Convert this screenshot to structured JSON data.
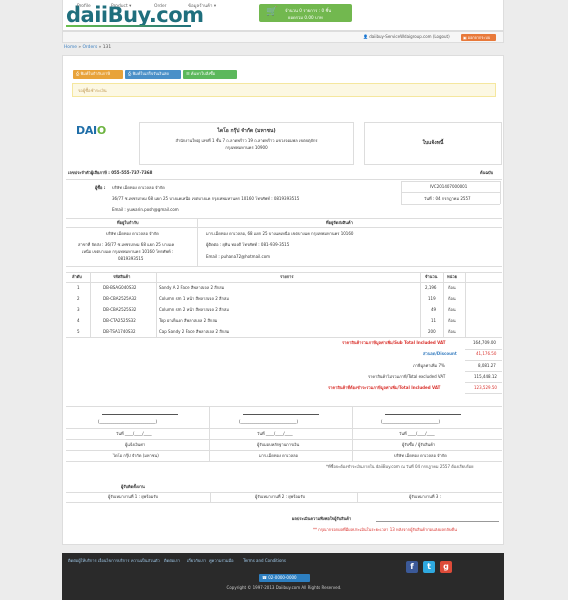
{
  "header": {
    "logo_text": "daiiBuy.com",
    "cart_line1": "จำนวน 0 รายการ : 0 ชิ้น",
    "cart_line2": "ยอดรวม 0.00 บาท",
    "user_text": "daiibuy-ServiceWdaigroup.com (Logout)",
    "logout_label": "ออกจากระบบ"
  },
  "nav": {
    "items": [
      "Profile",
      "Product ▾",
      "Order",
      "ข้อมูลร้านค้า ▾"
    ]
  },
  "breadcrumb": {
    "home": "Home",
    "orders": "Orders",
    "sep": "»",
    "current": "131"
  },
  "actions": {
    "print": "พิมพ์ใบกำกับภาษี",
    "print2": "พิมพ์ใบเสร็จรับเงินสด",
    "search": "ค้นหาใบสั่งซื้อ"
  },
  "notice": "รอผู้ซื้อชำระเงิน",
  "company": {
    "logo": "DAIO",
    "name": "ไดโอ กรุ๊ป จำกัด (มหาชน)",
    "addr1": "สำนักงานใหญ่ เลขที่ 1 ชั้น 7 ถ.ลาดพร้าว 19 ถ.ลาดพร้าว แขวงจอมพล เขตจตุจักร",
    "addr2": "กรุงเทพมหานคร 10900"
  },
  "tax": {
    "title": "ใบแจ้งหนี้",
    "invoice_no": "IVC201407000001",
    "date": "วันที่ : 04 กรกฎาคม 2557"
  },
  "seller_tax_id": "เลขประจำตัวผู้เสียภาษี : 055-555-737-7368",
  "original_label": "ต้นฉบับ",
  "customer": {
    "name_label": "ผู้ซื้อ :",
    "name": "บริษัท เม็ดทอง ดาเวลลอ จำกัด",
    "address": "36/77 ซ.เพชรเกษม 68 แยก 25 บางแคเหนือ เขตบางแค กรุงเทพมหานคร 10160 โทรศัพท์ : 0819393515",
    "email": "Email : yuwarin.posh@gmail.com"
  },
  "address_boxes": {
    "billing_title": "ที่อยู่ใบกำกับ",
    "billing_name": "บริษัท เม็ดทอง ดาเวลลอ จำกัด",
    "billing_addr": "สาขาที่ จัดส่ง : 36/77 ซ.เพชรเกษม 68 แยก 25 บางแค",
    "billing_addr2": "เหนือ เขตบางแค กรุงเทพมหานคร 10160 โทรศัพท์ :",
    "billing_phone": "0819393515",
    "shipping_title": "ที่อยู่จัดส่งสินค้า",
    "shipping_addr": "มาร.เม็ดทอง ดาเวลลอ, 68 แยก 25 บางแคเหนือ เขตบางแค กรุงเทพมหานคร 10160",
    "shipping_contact": "ผู้ติดต่อ : ยุพิน ทองดี โทรศัพท์ : 081-939-3515",
    "shipping_email": "Email : puhana72@hotmail.com"
  },
  "table": {
    "headers": [
      "ลำดับ",
      "รหัสสินค้า",
      "รายการ",
      "จำนวน",
      "หน่วย"
    ],
    "rows": [
      [
        "1",
        "DB-BSAG040S32",
        "Sandy A 2 Face สีพลาสเจล 2 สีกล่ม",
        "2,196",
        "ก้อน"
      ],
      [
        "2",
        "DB-CBA2525A32",
        "Column sm 1 หน้า สีพลาสเจล 2 สีกล่ม",
        "119",
        "ก้อน"
      ],
      [
        "3",
        "DB-CBA2525S32",
        "Column sm 2 หน้า สีพลาสเจล 2 สีกล่ม",
        "49",
        "ก้อน"
      ],
      [
        "4",
        "DB-CTA2525S32",
        "Top ฝาเห็นงก สีพลาสเจล 2 สีกล่ม",
        "11",
        "ก้อน"
      ],
      [
        "5",
        "DB-TSA1740S32",
        "Cap Sandy 2 Face สีพลาสเจล 2 สีกล่ม",
        "200",
        "ก้อน"
      ]
    ]
  },
  "totals": {
    "sub_label": "ราคาสินค้ารวมภาษีมูลค่าเพิ่ม/Sub Total Included VAT",
    "sub_value": "164,709.00",
    "discount_label": "ส่วนลด/Discount",
    "discount_value": "41,176.50",
    "vat_label": "ภาษีมูลค่าเพิ่ม 7%",
    "vat_value": "8,081.27",
    "total_label": "ราคาสินค้าไม่รวมภาษี/Total excluded VAT",
    "total_value": "115,448.12",
    "grand_label": "ราคาสินค้าที่ต้องชำระรวมภาษีมูลค่าเพิ่ม/Total Included VAT",
    "grand_value": "123,529.50"
  },
  "signatures": {
    "date": "วันที่ ____/____/____",
    "r1": [
      "ผู้แจ้งเงินค่า",
      "ผู้รับมอบหลักฐานการเงิน",
      "ผู้รับซื้อ / ผู้รับสินค้า"
    ],
    "r2": [
      "ไดโอ กรุ๊ป จำกัด (มหาชน)",
      "มาร.เม็ดทอง ดาเวลลอ",
      "บริษัท เม็ดทอง ดาเวลลอ จำกัด"
    ]
  },
  "note1": "*ที่ซื้อจะต้องชำระเงินภายใน daiiBuy.com ณ วันที่ 04 กรกฎาคม 2557 ต้องเรียบร้อย",
  "installer": {
    "title": "ผู้รับติดตั้งงาน",
    "p1": "ผู้รับเหมางานที่ 1 : ยุพร้อมรับ",
    "p2": "ผู้รับเหมางานที่ 2 : ยุพร้อมรับ",
    "p3": "ผู้รับเหมางานที่ 3 :"
  },
  "evaluation": "ผลประเมินความพึงพอใจผู้รับสินค้า",
  "note2": "** กรุณากรอกผลที่มีผลประเมินในระยะเวลา 13 หลังจากผู้รับสินค้าก่อนส่งผลกลับคืน",
  "footer": {
    "links": [
      "ติดต่อผู้ให้บริการ",
      "เงื่อนไขการบริการ",
      "ความเป็นส่วนตัว",
      "ติดต่อเรา",
      "เกี่ยวกับเรา",
      "คู่ความร่วมมือ",
      "Terms and Conditions"
    ],
    "phone": "02-0000-0000",
    "copyright": "Copyright © 1997-2013 Daiibuy.com All Rights Reserved.",
    "social": [
      "facebook-icon",
      "twitter-icon",
      "google-plus-icon"
    ]
  },
  "colors": {
    "brand": "#1f6f7d",
    "accent": "#72b84f",
    "warn": "#e8793a",
    "link": "#3a7fc1",
    "red": "#d9302b"
  }
}
